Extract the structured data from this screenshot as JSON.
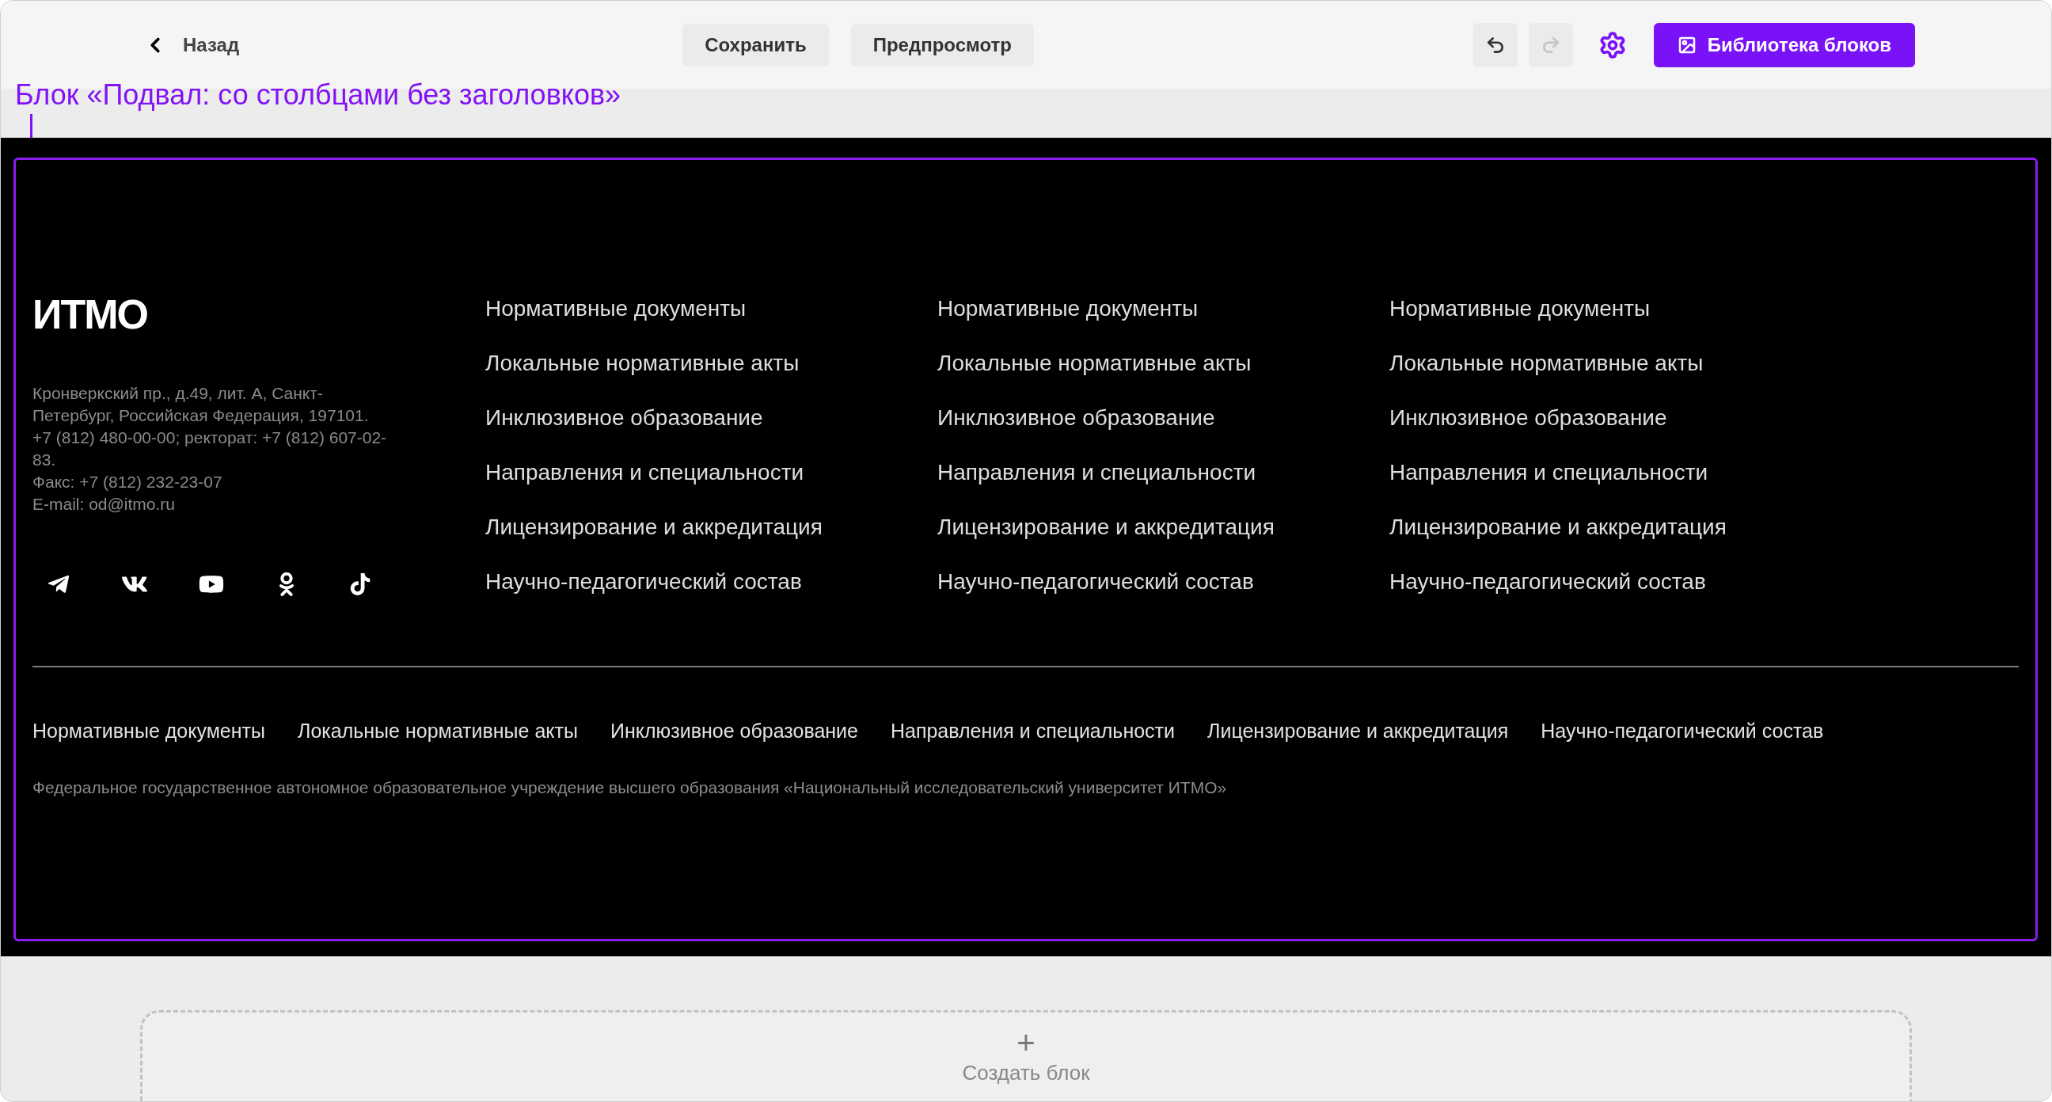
{
  "toolbar": {
    "back": "Назад",
    "buttons": [
      "Сохранить",
      "Предпросмотр"
    ],
    "undo_disabled": false,
    "redo_disabled": true,
    "library": "Библиотека блоков"
  },
  "block_label": "Блок «Подвал: со столбцами без заголовков»",
  "footer": {
    "logo": "ИТМО",
    "address_lines": [
      "Кронверкский пр., д.49, лит. А, Санкт-",
      "Петербург, Российская Федерация, 197101.",
      "+7 (812) 480-00-00; ректорат: +7 (812) 607-02-",
      "83.",
      "Факс: +7 (812) 232-23-07",
      "E-mail: od@itmo.ru"
    ],
    "socials": [
      {
        "kind": "telegram"
      },
      {
        "kind": "vk"
      },
      {
        "kind": "youtube"
      },
      {
        "kind": "ok"
      },
      {
        "kind": "tiktok"
      }
    ],
    "columns": [
      [
        "Нормативные документы",
        "Локальные нормативные акты",
        "Инклюзивное образование",
        "Направления и специальности",
        "Лицензирование и аккредитация",
        "Научно-педагогический состав"
      ],
      [
        "Нормативные документы",
        "Локальные нормативные акты",
        "Инклюзивное образование",
        "Направления и специальности",
        "Лицензирование и аккредитация",
        "Научно-педагогический состав"
      ],
      [
        "Нормативные документы",
        "Локальные нормативные акты",
        "Инклюзивное образование",
        "Направления и специальности",
        "Лицензирование и аккредитация",
        "Научно-педагогический состав"
      ]
    ],
    "bottom_links": [
      "Нормативные документы",
      "Локальные нормативные акты",
      "Инклюзивное образование",
      "Направления и специальности",
      "Лицензирование и аккредитация",
      "Научно-педагогический состав"
    ],
    "legal": "Федеральное государственное автономное образовательное учреждение высшего образования «Национальный исследовательский университет ИТМО»"
  },
  "create_block": {
    "icon": "+",
    "label": "Создать блок"
  }
}
